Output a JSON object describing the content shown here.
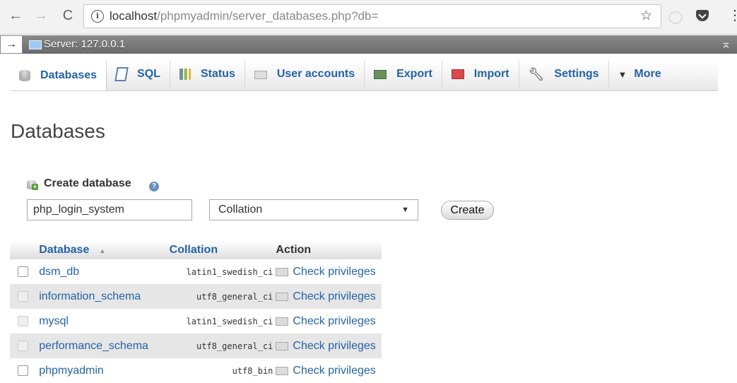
{
  "browser": {
    "url_host": "localhost",
    "url_path": "/phpmyadmin/server_databases.php?db="
  },
  "server": {
    "label": "Server: 127.0.0.1"
  },
  "tabs": [
    {
      "label": "Databases",
      "icon": "database-icon"
    },
    {
      "label": "SQL",
      "icon": "sql-icon"
    },
    {
      "label": "Status",
      "icon": "status-icon"
    },
    {
      "label": "User accounts",
      "icon": "user-accounts-icon"
    },
    {
      "label": "Export",
      "icon": "export-icon"
    },
    {
      "label": "Import",
      "icon": "import-icon"
    },
    {
      "label": "Settings",
      "icon": "wrench-icon"
    },
    {
      "label": "More",
      "icon": "triangle-down-icon"
    }
  ],
  "page_title": "Databases",
  "create": {
    "label": "Create database",
    "db_name_value": "php_login_system",
    "collation_value": "Collation",
    "button_label": "Create"
  },
  "table": {
    "headers": {
      "database": "Database",
      "collation": "Collation",
      "action": "Action"
    },
    "rows": [
      {
        "name": "dsm_db",
        "collation": "latin1_swedish_ci",
        "action": "Check privileges"
      },
      {
        "name": "information_schema",
        "collation": "utf8_general_ci",
        "action": "Check privileges"
      },
      {
        "name": "mysql",
        "collation": "latin1_swedish_ci",
        "action": "Check privileges"
      },
      {
        "name": "performance_schema",
        "collation": "utf8_general_ci",
        "action": "Check privileges"
      },
      {
        "name": "phpmyadmin",
        "collation": "utf8_bin",
        "action": "Check privileges"
      }
    ]
  }
}
